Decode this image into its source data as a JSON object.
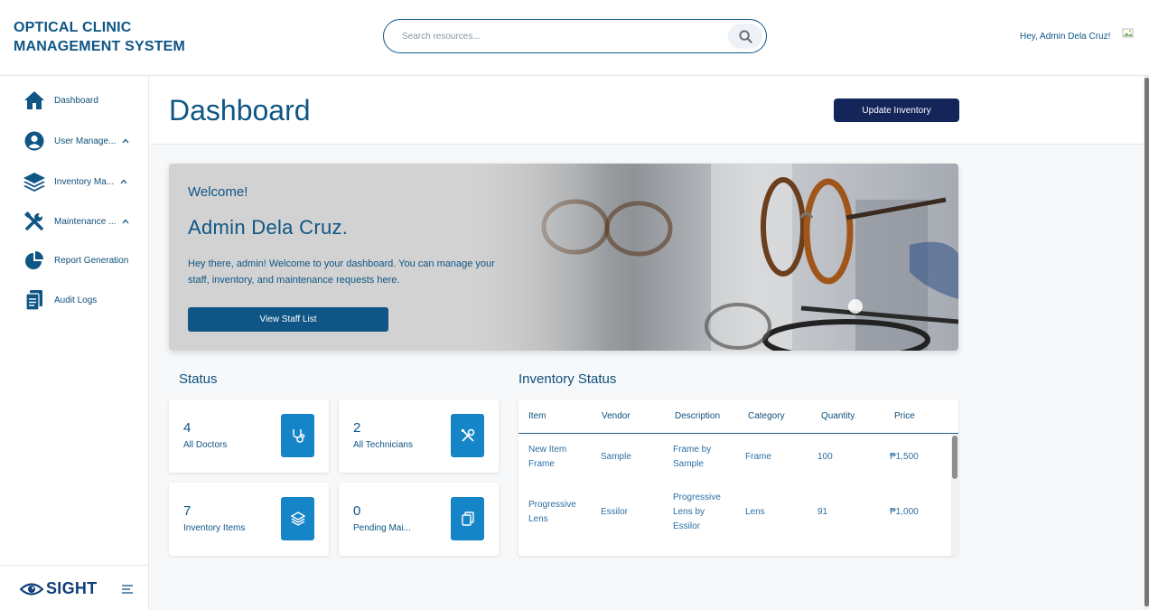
{
  "app": {
    "title_line1": "OPTICAL CLINIC",
    "title_line2": "MANAGEMENT SYSTEM"
  },
  "search": {
    "placeholder": "Search resources..."
  },
  "user": {
    "greeting": "Hey, Admin Dela Cruz!"
  },
  "sidebar": {
    "items": [
      {
        "label": "Dashboard",
        "icon": "home-icon"
      },
      {
        "label": "User Manage...",
        "icon": "user-circle-icon",
        "expandable": true
      },
      {
        "label": "Inventory Ma...",
        "icon": "layers-icon",
        "expandable": true
      },
      {
        "label": "Maintenance ...",
        "icon": "tools-icon",
        "expandable": true
      },
      {
        "label": "Report Generation",
        "icon": "pie-chart-icon"
      },
      {
        "label": "Audit Logs",
        "icon": "clipboard-icon"
      }
    ],
    "logo_text": "SIGHT"
  },
  "page": {
    "title": "Dashboard",
    "update_button": "Update Inventory"
  },
  "welcome": {
    "small": "Welcome!",
    "name": "Admin Dela Cruz.",
    "description": "Hey there, admin! Welcome to your dashboard. You can manage your staff, inventory, and maintenance requests here.",
    "button": "View Staff List"
  },
  "status": {
    "title": "Status",
    "cards": [
      {
        "count": "4",
        "label": "All Doctors",
        "icon": "stethoscope-icon"
      },
      {
        "count": "2",
        "label": "All Technicians",
        "icon": "tools-icon"
      },
      {
        "count": "7",
        "label": "Inventory Items",
        "icon": "layers-icon"
      },
      {
        "count": "0",
        "label": "Pending Mai...",
        "icon": "copy-icon"
      }
    ]
  },
  "inventory": {
    "title": "Inventory Status",
    "columns": [
      "Item",
      "Vendor",
      "Description",
      "Category",
      "Quantity",
      "Price"
    ],
    "rows": [
      {
        "item": "New Item Frame",
        "vendor": "Sample",
        "description": "Frame by Sample",
        "category": "Frame",
        "quantity": "100",
        "price": "₱1,500"
      },
      {
        "item": "Progressive Lens",
        "vendor": "Essilor",
        "description": "Progressive Lens by Essilor",
        "category": "Lens",
        "quantity": "91",
        "price": "₱1,000"
      }
    ]
  },
  "colors": {
    "primary": "#0f5585",
    "navy_button": "#14255a",
    "accent_blue": "#1585c8",
    "background": "#f6f8fa"
  }
}
